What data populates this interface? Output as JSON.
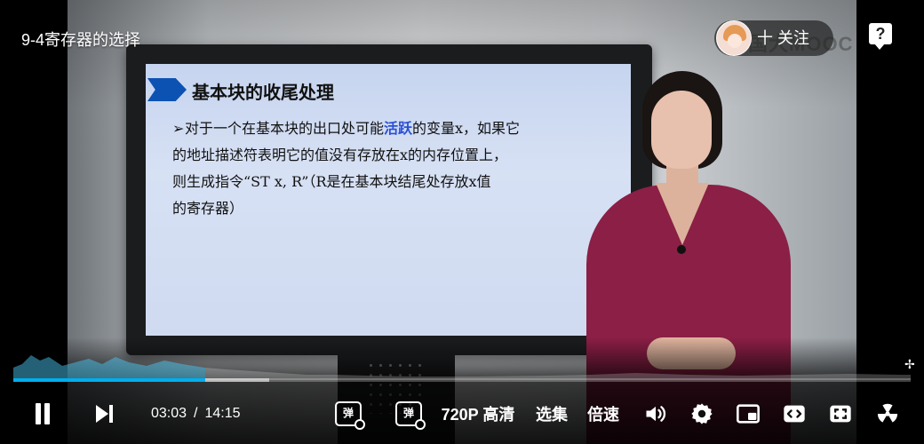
{
  "video": {
    "title": "9-4寄存器的选择",
    "watermark": "国大MOOC"
  },
  "slide": {
    "title": "基本块的收尾处理",
    "bullet": "➢",
    "line1_a": "对于一个在基本块的出口处可能",
    "line1_hl": "活跃",
    "line1_b": "的变量x，如果它",
    "line2": "的地址描述符表明它的值没有存放在x的内存位置上，",
    "line3": "则生成指令“ST x, R”（R是在基本块结尾处存放x值",
    "line4": "的寄存器）"
  },
  "uploader": {
    "follow_label": "十 关注"
  },
  "help": {
    "label": "?"
  },
  "playback": {
    "current_time": "03:03",
    "separator": "/",
    "duration": "14:15",
    "progress_fraction": 0.214,
    "buffered_fraction": 0.285
  },
  "controls": {
    "danmaku_label": "弹",
    "quality_label": "720P 高清",
    "episodes_label": "选集",
    "speed_label": "倍速"
  },
  "colors": {
    "accent": "#00aeec",
    "slide_highlight": "#2a50d6",
    "shirt": "#8b1f45"
  }
}
